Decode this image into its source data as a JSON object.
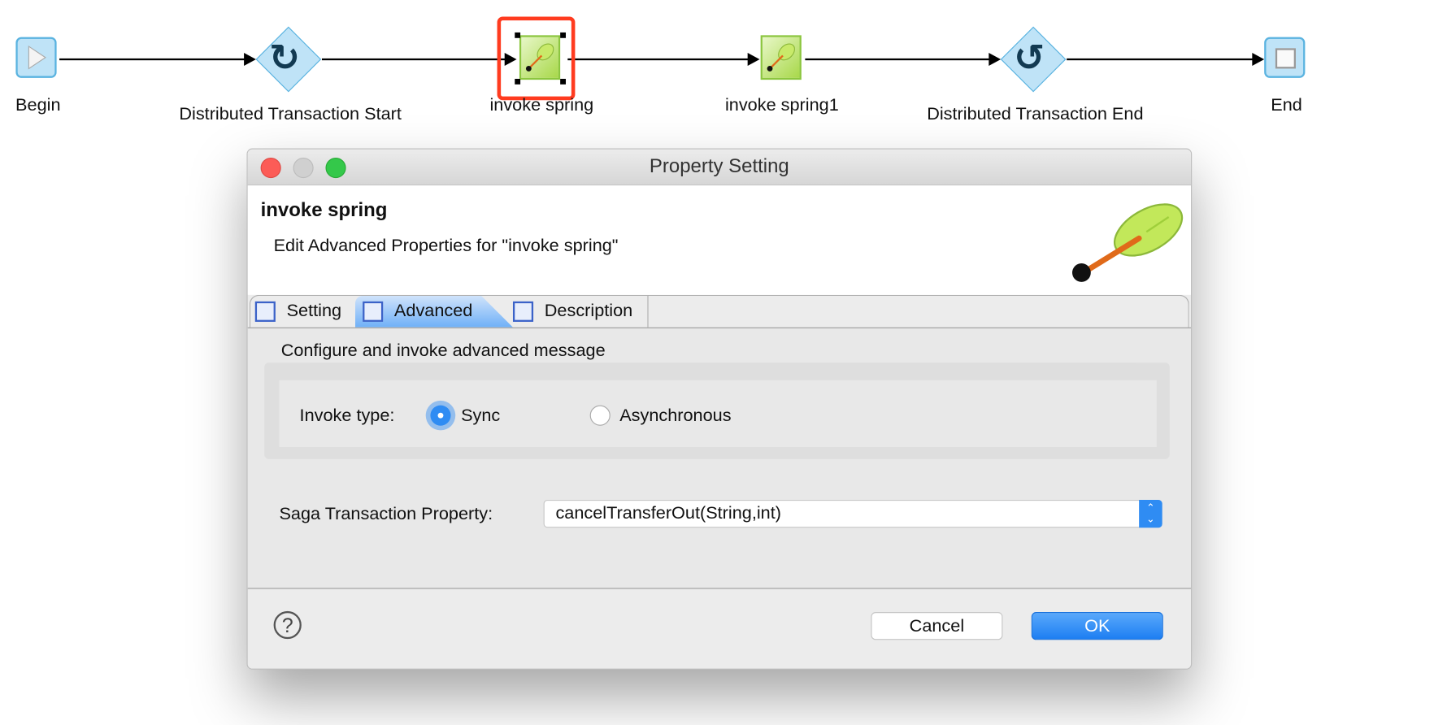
{
  "flow": {
    "nodes": [
      {
        "label": "Begin",
        "icon": "play-icon"
      },
      {
        "label": "Distributed Transaction Start",
        "icon": "rotate-clockwise-icon"
      },
      {
        "label": "invoke spring",
        "icon": "spring-leaf-icon",
        "selected": true
      },
      {
        "label": "invoke spring1",
        "icon": "spring-leaf-icon"
      },
      {
        "label": "Distributed Transaction End",
        "icon": "rotate-counterclockwise-icon"
      },
      {
        "label": "End",
        "icon": "stop-icon"
      }
    ],
    "highlight_color": "#ff3b1f"
  },
  "dialog": {
    "title": "Property Setting",
    "header_title": "invoke spring",
    "header_subtitle": "Edit Advanced Properties for \"invoke spring\"",
    "tabs": [
      {
        "label": "Setting",
        "active": false
      },
      {
        "label": "Advanced",
        "active": true
      },
      {
        "label": "Description",
        "active": false
      }
    ],
    "section_title": "Configure and invoke advanced message",
    "invoke_type_label": "Invoke type:",
    "invoke_options": [
      "Sync",
      "Asynchronous"
    ],
    "invoke_selected": "Sync",
    "saga_label": "Saga Transaction Property:",
    "saga_value": "cancelTransferOut(String,int)",
    "cancel_label": "Cancel",
    "ok_label": "OK",
    "help_glyph": "?",
    "accent_color": "#2f8cf3"
  }
}
